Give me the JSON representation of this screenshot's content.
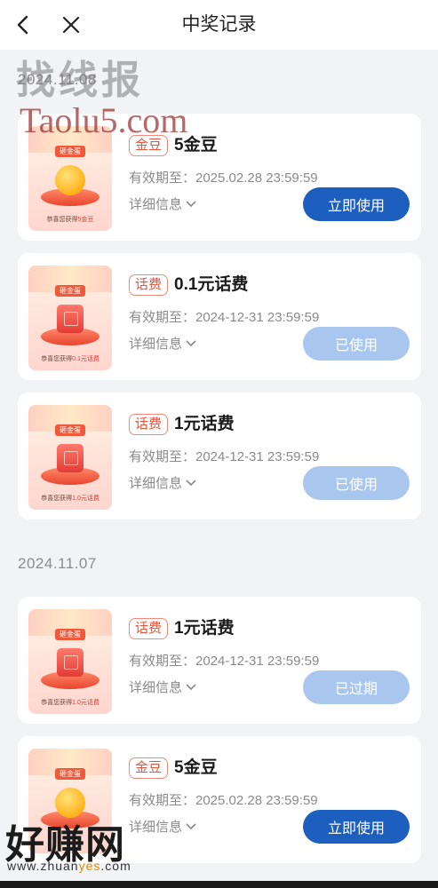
{
  "header": {
    "title": "中奖记录",
    "back_icon": "chevron-left-icon",
    "close_icon": "close-icon"
  },
  "groups": [
    {
      "date": "2024.11.08",
      "records": [
        {
          "type_badge": "金豆",
          "prize": "5金豆",
          "valid_label": "有效期至：2025.02.28 23:59:59",
          "detail_label": "详细信息",
          "button_label": "立即使用",
          "button_state": "active",
          "thumb_kind": "coin",
          "thumb_tag": "砸金蛋",
          "thumb_caption": "恭喜您获得",
          "thumb_caption_value": "5金豆"
        },
        {
          "type_badge": "话费",
          "prize": "0.1元话费",
          "valid_label": "有效期至：2024-12-31 23:59:59",
          "detail_label": "详细信息",
          "button_label": "已使用",
          "button_state": "disabled",
          "thumb_kind": "box",
          "thumb_tag": "砸金蛋",
          "thumb_caption": "恭喜您获得",
          "thumb_caption_value": "0.1元话费"
        },
        {
          "type_badge": "话费",
          "prize": "1元话费",
          "valid_label": "有效期至：2024-12-31 23:59:59",
          "detail_label": "详细信息",
          "button_label": "已使用",
          "button_state": "disabled",
          "thumb_kind": "box",
          "thumb_tag": "砸金蛋",
          "thumb_caption": "恭喜您获得",
          "thumb_caption_value": "1.0元话费"
        }
      ]
    },
    {
      "date": "2024.11.07",
      "records": [
        {
          "type_badge": "话费",
          "prize": "1元话费",
          "valid_label": "有效期至：2024-12-31 23:59:59",
          "detail_label": "详细信息",
          "button_label": "已过期",
          "button_state": "disabled",
          "thumb_kind": "box",
          "thumb_tag": "砸金蛋",
          "thumb_caption": "恭喜您获得",
          "thumb_caption_value": "1.0元话费"
        },
        {
          "type_badge": "金豆",
          "prize": "5金豆",
          "valid_label": "有效期至：2025.02.28 23:59:59",
          "detail_label": "详细信息",
          "button_label": "立即使用",
          "button_state": "active",
          "thumb_kind": "coin",
          "thumb_tag": "砸金蛋",
          "thumb_caption": "",
          "thumb_caption_value": ""
        }
      ]
    }
  ],
  "watermarks": {
    "top_cn": "找线报",
    "top_en": "Taolu5.com",
    "bottom_cn": "好赚网",
    "bottom_url_prefix": "www.zhuan",
    "bottom_url_accent": "yes",
    "bottom_url_suffix": ".com"
  },
  "colors": {
    "primary_button": "#1c5fbf",
    "disabled_button": "#a9c7ee",
    "badge_red": "#e8553e"
  }
}
